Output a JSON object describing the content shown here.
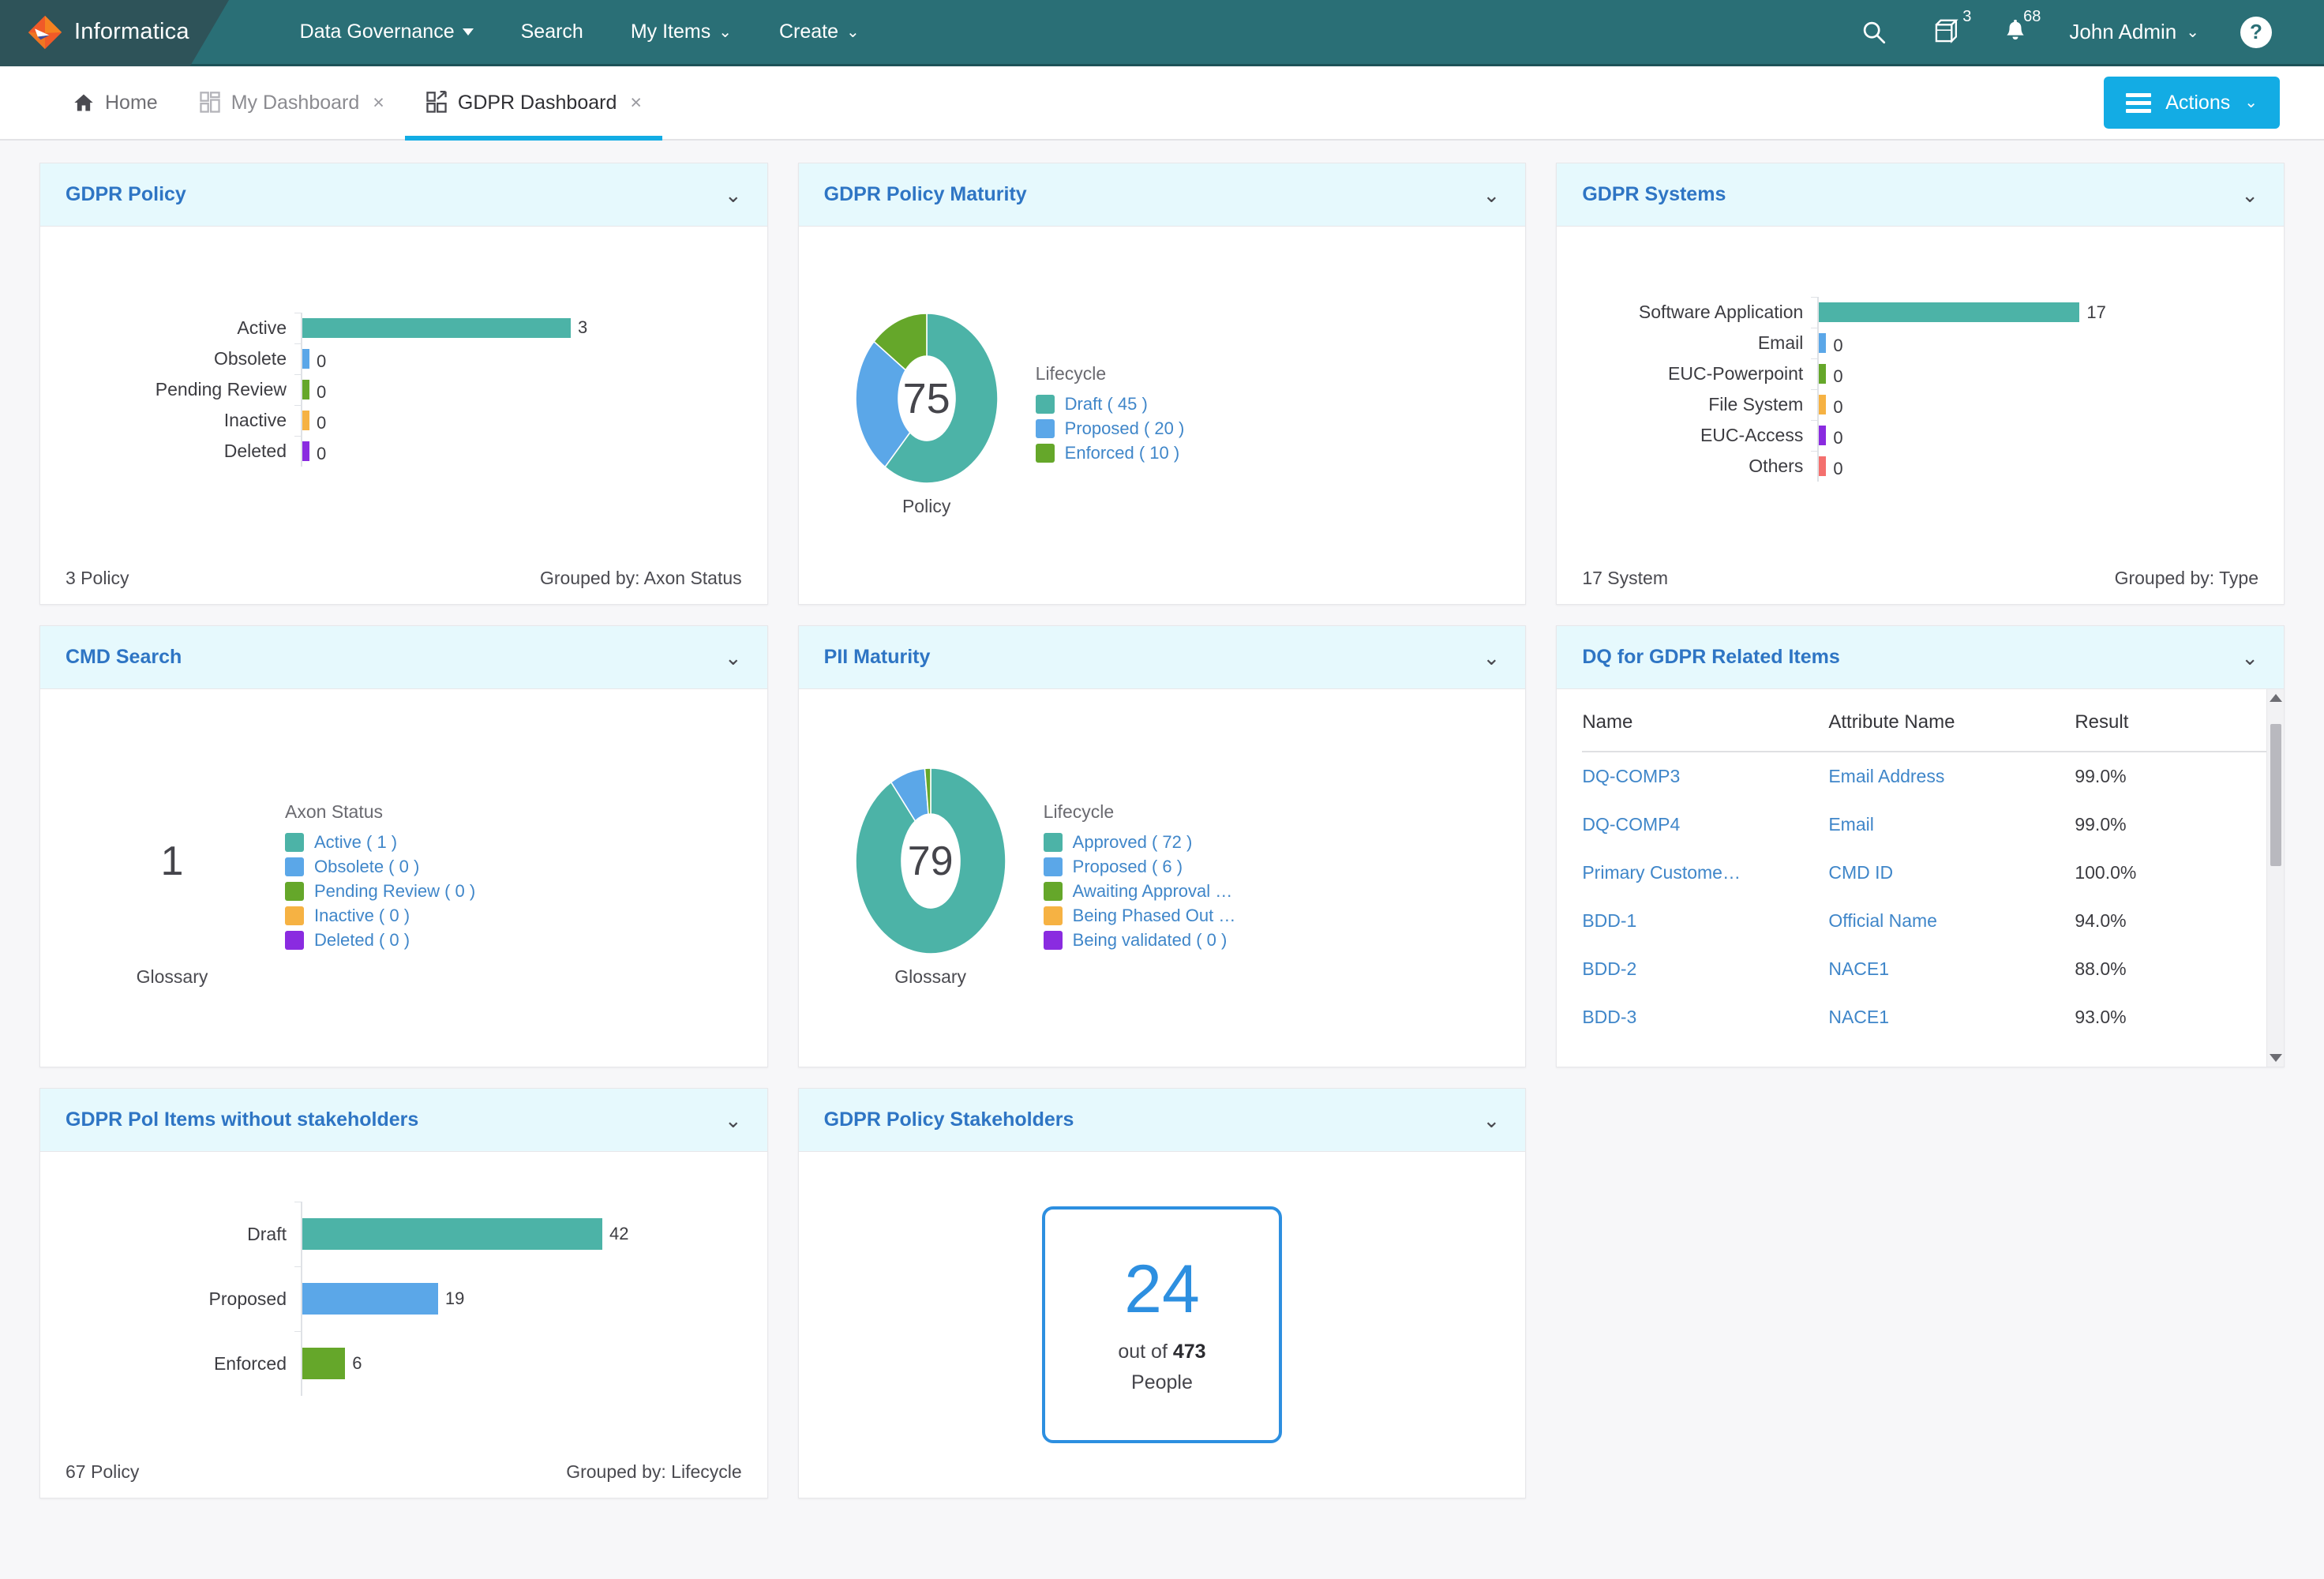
{
  "brand": {
    "name": "Informatica",
    "accent_teal": "#2a6f76",
    "accent_cyan": "#13ace4",
    "chart_teal": "#4cb3a7",
    "chart_blue": "#5ba7e8",
    "chart_green": "#65a72a",
    "chart_orange": "#f6b243",
    "chart_purple": "#8a2be0",
    "chart_red": "#f4706e"
  },
  "topnav": {
    "items": [
      {
        "label": "Data Governance",
        "icon": "caret-down-icon",
        "has_caret": true
      },
      {
        "label": "Search",
        "icon": "",
        "has_caret": false
      },
      {
        "label": "My Items",
        "icon": "chevron-down-icon",
        "has_caret": false
      },
      {
        "label": "Create",
        "icon": "chevron-down-icon",
        "has_caret": false
      }
    ],
    "search_icon": "search-icon",
    "cube_icon": "cube-icon",
    "cube_badge": "3",
    "bell_icon": "bell-icon",
    "bell_badge": "68",
    "user": "John Admin",
    "help_label": "?"
  },
  "tabbar": {
    "tabs": [
      {
        "label": "Home",
        "icon": "home-icon",
        "closable": false,
        "active": false
      },
      {
        "label": "My Dashboard",
        "icon": "dashboard-icon",
        "closable": true,
        "active": false
      },
      {
        "label": "GDPR Dashboard",
        "icon": "dashboard-link-icon",
        "closable": true,
        "active": true
      }
    ],
    "close_glyph": "×",
    "actions_label": "Actions",
    "actions_caret": "ˇ"
  },
  "widgets": {
    "gdpr_policy": {
      "title": "GDPR Policy",
      "footer_left": "3 Policy",
      "footer_right": "Grouped by: Axon Status"
    },
    "gdpr_policy_maturity": {
      "title": "GDPR Policy Maturity"
    },
    "gdpr_systems": {
      "title": "GDPR Systems",
      "footer_left": "17 System",
      "footer_right": "Grouped by: Type"
    },
    "cmd_search": {
      "title": "CMD Search"
    },
    "pii_maturity": {
      "title": "PII Maturity"
    },
    "dq_items": {
      "title": "DQ for GDPR Related Items",
      "columns": [
        "Name",
        "Attribute Name",
        "Result"
      ],
      "rows": [
        {
          "name": "DQ-COMP3",
          "attribute": "Email Address",
          "result": "99.0%"
        },
        {
          "name": "DQ-COMP4",
          "attribute": "Email",
          "result": "99.0%"
        },
        {
          "name": "Primary Custome…",
          "attribute": "CMD ID",
          "result": "100.0%"
        },
        {
          "name": "BDD-1",
          "attribute": "Official Name",
          "result": "94.0%"
        },
        {
          "name": "BDD-2",
          "attribute": "NACE1",
          "result": "88.0%"
        },
        {
          "name": "BDD-3",
          "attribute": "NACE1",
          "result": "93.0%"
        }
      ]
    },
    "pol_no_stakeholders": {
      "title": "GDPR Pol Items without stakeholders",
      "footer_left": "67 Policy",
      "footer_right": "Grouped by: Lifecycle"
    },
    "policy_stakeholders": {
      "title": "GDPR Policy Stakeholders",
      "value": "24",
      "out_of_prefix": "out of",
      "total": "473",
      "unit": "People"
    }
  },
  "chart_data": [
    {
      "id": "gdpr_policy",
      "type": "bar",
      "orientation": "horizontal",
      "title": "GDPR Policy",
      "xlabel": "",
      "ylabel": "",
      "grouped_by": "Axon Status",
      "total_label": "3 Policy",
      "categories": [
        "Active",
        "Obsolete",
        "Pending Review",
        "Inactive",
        "Deleted"
      ],
      "values": [
        3,
        0,
        0,
        0,
        0
      ],
      "colors": [
        "#4cb3a7",
        "#5ba7e8",
        "#65a72a",
        "#f6b243",
        "#8a2be0"
      ],
      "xlim": [
        0,
        3
      ]
    },
    {
      "id": "gdpr_policy_maturity",
      "type": "pie",
      "variant": "donut",
      "title": "GDPR Policy Maturity",
      "center_value": "75",
      "caption": "Policy",
      "legend_title": "Lifecycle",
      "legend_position": "right",
      "labels": [
        "Draft ( 45 )",
        "Proposed ( 20 )",
        "Enforced ( 10 )"
      ],
      "categories": [
        "Draft",
        "Proposed",
        "Enforced"
      ],
      "values": [
        45,
        20,
        10
      ],
      "colors": [
        "#4cb3a7",
        "#5ba7e8",
        "#65a72a"
      ]
    },
    {
      "id": "gdpr_systems",
      "type": "bar",
      "orientation": "horizontal",
      "title": "GDPR Systems",
      "grouped_by": "Type",
      "total_label": "17 System",
      "categories": [
        "Software Application",
        "Email",
        "EUC-Powerpoint",
        "File System",
        "EUC-Access",
        "Others"
      ],
      "values": [
        17,
        0,
        0,
        0,
        0,
        0
      ],
      "colors": [
        "#4cb3a7",
        "#5ba7e8",
        "#65a72a",
        "#f6b243",
        "#8a2be0",
        "#f4706e"
      ],
      "xlim": [
        0,
        17
      ]
    },
    {
      "id": "cmd_search",
      "type": "pie",
      "variant": "donut",
      "title": "CMD Search",
      "center_value": "1",
      "caption": "Glossary",
      "legend_title": "Axon Status",
      "legend_position": "right",
      "labels": [
        "Active ( 1 )",
        "Obsolete ( 0 )",
        "Pending Review ( 0 )",
        "Inactive ( 0 )",
        "Deleted ( 0 )"
      ],
      "categories": [
        "Active",
        "Obsolete",
        "Pending Review",
        "Inactive",
        "Deleted"
      ],
      "values": [
        1,
        0,
        0,
        0,
        0
      ],
      "colors": [
        "#4cb3a7",
        "#5ba7e8",
        "#65a72a",
        "#f6b243",
        "#8a2be0"
      ]
    },
    {
      "id": "pii_maturity",
      "type": "pie",
      "variant": "donut",
      "title": "PII Maturity",
      "center_value": "79",
      "caption": "Glossary",
      "legend_title": "Lifecycle",
      "legend_position": "right",
      "labels": [
        "Approved ( 72 )",
        "Proposed ( 6 )",
        "Awaiting Approval …",
        "Being Phased Out …",
        "Being validated ( 0 )"
      ],
      "categories": [
        "Approved",
        "Proposed",
        "Awaiting Approval",
        "Being Phased Out",
        "Being validated"
      ],
      "values": [
        72,
        6,
        1,
        0,
        0
      ],
      "colors": [
        "#4cb3a7",
        "#5ba7e8",
        "#65a72a",
        "#f6b243",
        "#8a2be0"
      ]
    },
    {
      "id": "dq_items",
      "type": "table",
      "title": "DQ for GDPR Related Items",
      "columns": [
        "Name",
        "Attribute Name",
        "Result"
      ],
      "rows": [
        [
          "DQ-COMP3",
          "Email Address",
          "99.0%"
        ],
        [
          "DQ-COMP4",
          "Email",
          "99.0%"
        ],
        [
          "Primary Custome…",
          "CMD ID",
          "100.0%"
        ],
        [
          "BDD-1",
          "Official Name",
          "94.0%"
        ],
        [
          "BDD-2",
          "NACE1",
          "88.0%"
        ],
        [
          "BDD-3",
          "NACE1",
          "93.0%"
        ]
      ]
    },
    {
      "id": "pol_no_stakeholders",
      "type": "bar",
      "orientation": "horizontal",
      "title": "GDPR Pol Items without stakeholders",
      "grouped_by": "Lifecycle",
      "total_label": "67 Policy",
      "categories": [
        "Draft",
        "Proposed",
        "Enforced"
      ],
      "values": [
        42,
        19,
        6
      ],
      "colors": [
        "#4cb3a7",
        "#5ba7e8",
        "#65a72a"
      ],
      "xlim": [
        0,
        42
      ]
    },
    {
      "id": "policy_stakeholders",
      "type": "kpi",
      "title": "GDPR Policy Stakeholders",
      "value": 24,
      "total": 473,
      "unit": "People"
    }
  ]
}
